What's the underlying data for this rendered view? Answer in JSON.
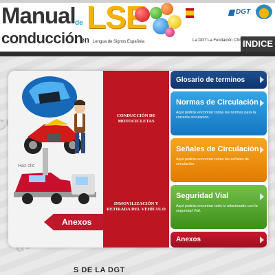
{
  "header": {
    "brand_manual": "Manual",
    "brand_de": "de",
    "brand_lse": "LSE",
    "brand_conduccion": "conducción",
    "brand_en": "en",
    "brand_subtitle": "Lengua de Signos Española",
    "dgt_logo": "DGT",
    "nav_links": [
      "La DGT",
      "La Fundación CNSE"
    ],
    "indice": "INDICE"
  },
  "left_panel": {
    "hint_text": "Haz clic",
    "items": [
      "CONDUCCIÓN DE MOTOCICLETAS",
      "INMOVILIZACIÓN Y RETIRADA DEL VEHÍCULO"
    ],
    "anexos": "Anexos"
  },
  "menu": [
    {
      "title": "Glosario de terminos",
      "desc": "",
      "color": "#1f4f8f"
    },
    {
      "title": "Normas de Circulación",
      "desc": "Aquí podrás encontrar todas las normas para la correcta circulación.",
      "color": "#2a93d8"
    },
    {
      "title": "Señales de Circulación",
      "desc": "Aquí podrás encontrar todas las señales de circulación.",
      "color": "#f08f10"
    },
    {
      "title": "Seguridad Vial",
      "desc": "Aquí podrás encontrar todo lo relacionado con la seguridad Vial.",
      "color": "#58a931"
    },
    {
      "title": "Anexos",
      "desc": "",
      "color": "#b8142a"
    }
  ],
  "footer": {
    "text": "S DE LA DGT"
  },
  "icons": {
    "menu_arrow": "chevron-right-icon"
  }
}
